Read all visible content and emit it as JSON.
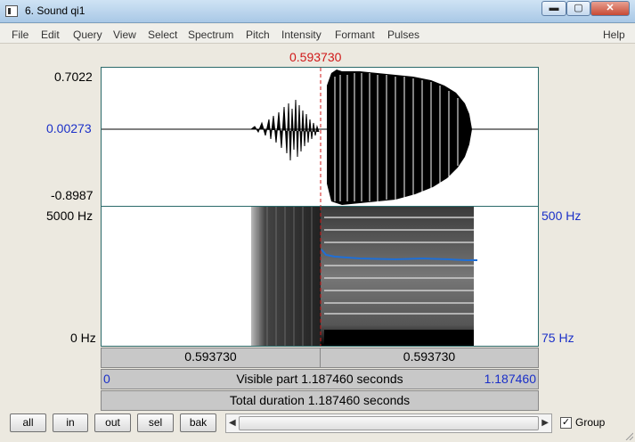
{
  "window": {
    "title": "6. Sound qi1",
    "minimize_label": "▬",
    "maximize_label": "▢",
    "close_label": "✕"
  },
  "menu": [
    "File",
    "Edit",
    "Query",
    "View",
    "Select",
    "Spectrum",
    "Pitch",
    "Intensity",
    "Formant",
    "Pulses",
    "Help"
  ],
  "cursor": {
    "time": "0.593730"
  },
  "waveform": {
    "max": "0.7022",
    "value_at_cursor": "0.00273",
    "min": "-0.8987"
  },
  "spectrogram": {
    "freq_top": "5000 Hz",
    "freq_bottom": "0 Hz",
    "pitch_top": "500 Hz",
    "pitch_bottom": "75 Hz"
  },
  "time_bars": {
    "left_segment": "0.593730",
    "right_segment": "0.593730",
    "visible_start": "0",
    "visible_label": "Visible part 1.187460 seconds",
    "visible_end": "1.187460",
    "total_label": "Total duration 1.187460 seconds"
  },
  "buttons": {
    "all": "all",
    "in": "in",
    "out": "out",
    "sel": "sel",
    "bak": "bak"
  },
  "scroll": {
    "left_arrow": "◀",
    "right_arrow": "▶"
  },
  "group": {
    "label": "Group",
    "checked": true,
    "check_mark": "✓"
  },
  "colors": {
    "cursor": "#d01818",
    "pitch_curve": "#1f6fd6",
    "value_label": "#1a2fc8"
  }
}
